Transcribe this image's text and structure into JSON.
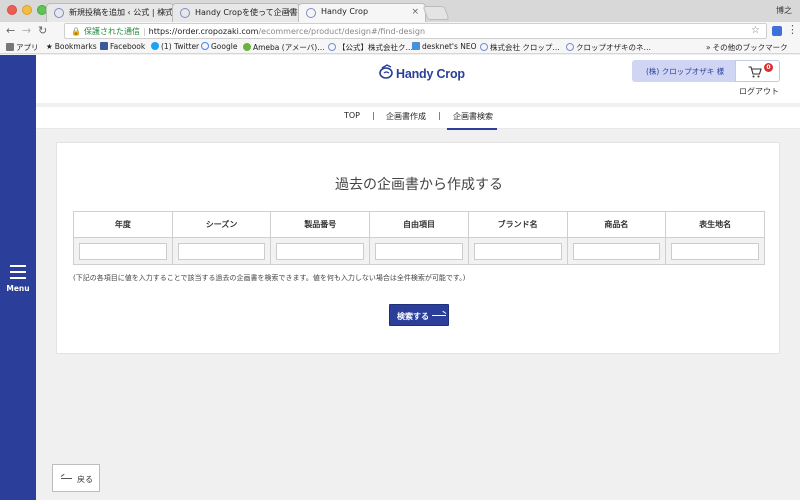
{
  "browser": {
    "tabs": [
      {
        "title": "新規投稿を追加 ‹ 公式 | 株式会社",
        "active": false
      },
      {
        "title": "Handy Cropを使って企画書を作",
        "active": false
      },
      {
        "title": "Handy Crop",
        "active": true
      }
    ],
    "profile_name": "博之",
    "url": {
      "secure_label": "保護された通信",
      "host": "https://order.cropozaki.com",
      "path": "/ecommerce/product/design#/find-design"
    },
    "bookmarks": [
      {
        "label": "アプリ",
        "icon": "apps-grid-icon"
      },
      {
        "label": "Bookmarks",
        "icon": "star-icon"
      },
      {
        "label": "Facebook",
        "icon": "facebook-icon"
      },
      {
        "label": "(1) Twitter",
        "icon": "twitter-icon"
      },
      {
        "label": "Google",
        "icon": "globe-icon"
      },
      {
        "label": "Ameba (アメーバ)…",
        "icon": "ameba-icon"
      },
      {
        "label": "【公式】株式会社ク…",
        "icon": "globe-icon"
      },
      {
        "label": "desknet's NEO",
        "icon": "desknets-icon"
      },
      {
        "label": "株式会社 クロップ…",
        "icon": "globe-icon"
      },
      {
        "label": "クロップオザキのネ…",
        "icon": "globe-icon"
      }
    ],
    "other_bookmarks_label": "その他のブックマーク"
  },
  "sidebar": {
    "menu_label": "Menu"
  },
  "header": {
    "logo_text": "Handy Crop",
    "company_name": "(株) クロップオザキ 様",
    "cart_count": "0",
    "logout_label": "ログアウト"
  },
  "subnav": {
    "items": [
      {
        "label": "TOP",
        "active": false
      },
      {
        "label": "企画書作成",
        "active": false
      },
      {
        "label": "企画書検索",
        "active": true
      }
    ],
    "separator": "|"
  },
  "search": {
    "title": "過去の企画書から作成する",
    "columns": [
      "年度",
      "シーズン",
      "製品番号",
      "自由項目",
      "ブランド名",
      "商品名",
      "表生地名"
    ],
    "note": "(下記の各項目に値を入力することで該当する過去の企画書を検索できます。値を何も入力しない場合は全件検索が可能です。)",
    "button_label": "検索する"
  },
  "footer": {
    "back_label": "戻る"
  },
  "colors": {
    "brand": "#2a3e9a",
    "company_box_bg": "#cfd5f2",
    "cart_badge": "#d92f2f"
  }
}
